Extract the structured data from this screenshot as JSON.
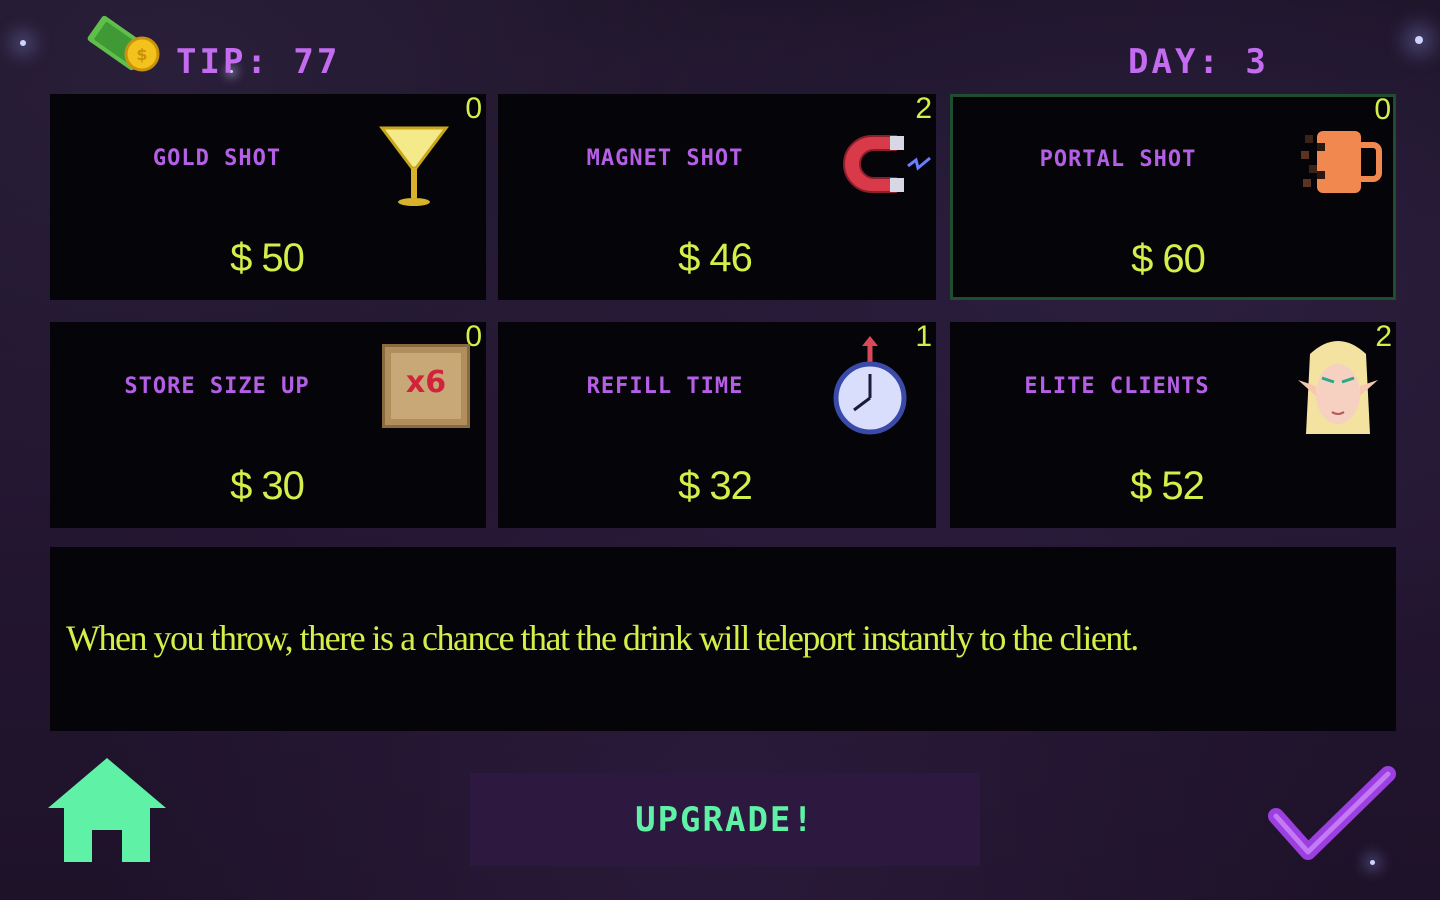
{
  "hud": {
    "tip_label": "TIP:",
    "tip_value": "77",
    "day_label": "DAY:",
    "day_value": "3",
    "money_icon": "cash-with-coin-icon"
  },
  "upgrades": [
    {
      "title": "GOLD SHOT",
      "price": "$ 50",
      "count": "0",
      "icon": "cocktail-glass-icon",
      "selected": false
    },
    {
      "title": "MAGNET SHOT",
      "price": "$ 46",
      "count": "2",
      "icon": "magnet-icon",
      "selected": false
    },
    {
      "title": "PORTAL SHOT",
      "price": "$ 60",
      "count": "0",
      "icon": "dissolving-mug-icon",
      "selected": true
    },
    {
      "title": "STORE SIZE UP",
      "price": "$ 30",
      "count": "0",
      "icon": "wooden-crate-icon",
      "icon_label": "x6",
      "selected": false
    },
    {
      "title": "REFILL TIME",
      "price": "$ 32",
      "count": "1",
      "icon": "stopwatch-icon",
      "selected": false
    },
    {
      "title": "ELITE CLIENTS",
      "price": "$ 52",
      "count": "2",
      "icon": "elf-face-icon",
      "selected": false
    }
  ],
  "description": "When you throw, there is a chance that the drink will teleport instantly to the client.",
  "actions": {
    "upgrade_label": "UPGRADE!",
    "home_icon": "home-icon",
    "confirm_icon": "checkmark-icon"
  },
  "colors": {
    "title_purple": "#b45fe6",
    "price_yellow": "#d4ee4a",
    "button_green": "#5ff2a6",
    "selected_border": "#1f4d2f",
    "check_purple": "#9b3fe0"
  }
}
